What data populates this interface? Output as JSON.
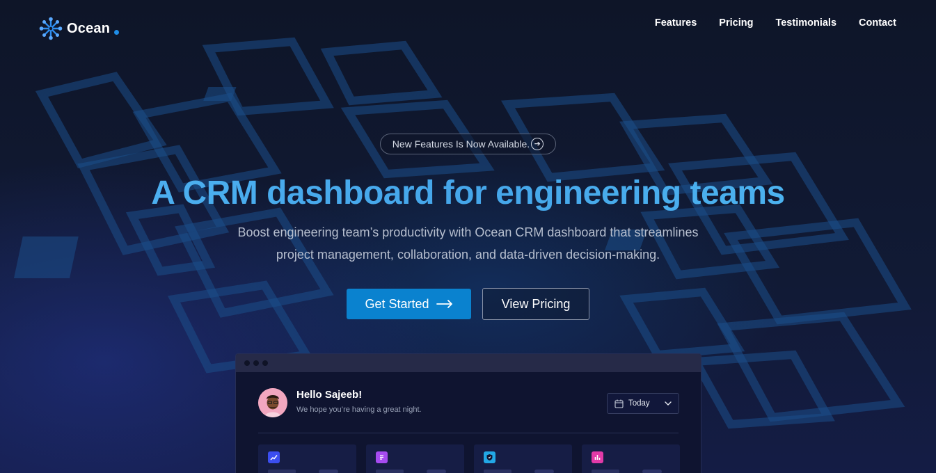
{
  "brand": {
    "name": "Ocean"
  },
  "nav": {
    "items": [
      "Features",
      "Pricing",
      "Testimonials",
      "Contact"
    ]
  },
  "hero": {
    "badge": "New Features Is Now Available.",
    "title": "A CRM dashboard for engineering teams",
    "subtitle_line1": "Boost engineering team’s productivity with Ocean CRM dashboard that streamlines",
    "subtitle_line2": "project management, collaboration, and data-driven decision-making.",
    "primary_cta": "Get Started",
    "secondary_cta": "View Pricing"
  },
  "preview": {
    "greeting": "Hello Sajeeb!",
    "greeting_sub": "We hope you’re having a great night.",
    "date_filter": "Today",
    "cards": [
      {
        "icon": "trend-icon",
        "color": "#3b4ef0"
      },
      {
        "icon": "document-icon",
        "color": "#a64bf0"
      },
      {
        "icon": "shield-icon",
        "color": "#22a8e6"
      },
      {
        "icon": "bar-chart-icon",
        "color": "#e23aa8"
      }
    ]
  },
  "colors": {
    "accent": "#0a82cf",
    "title_gradient": "#4fb3f2",
    "background": "#0f1629"
  }
}
